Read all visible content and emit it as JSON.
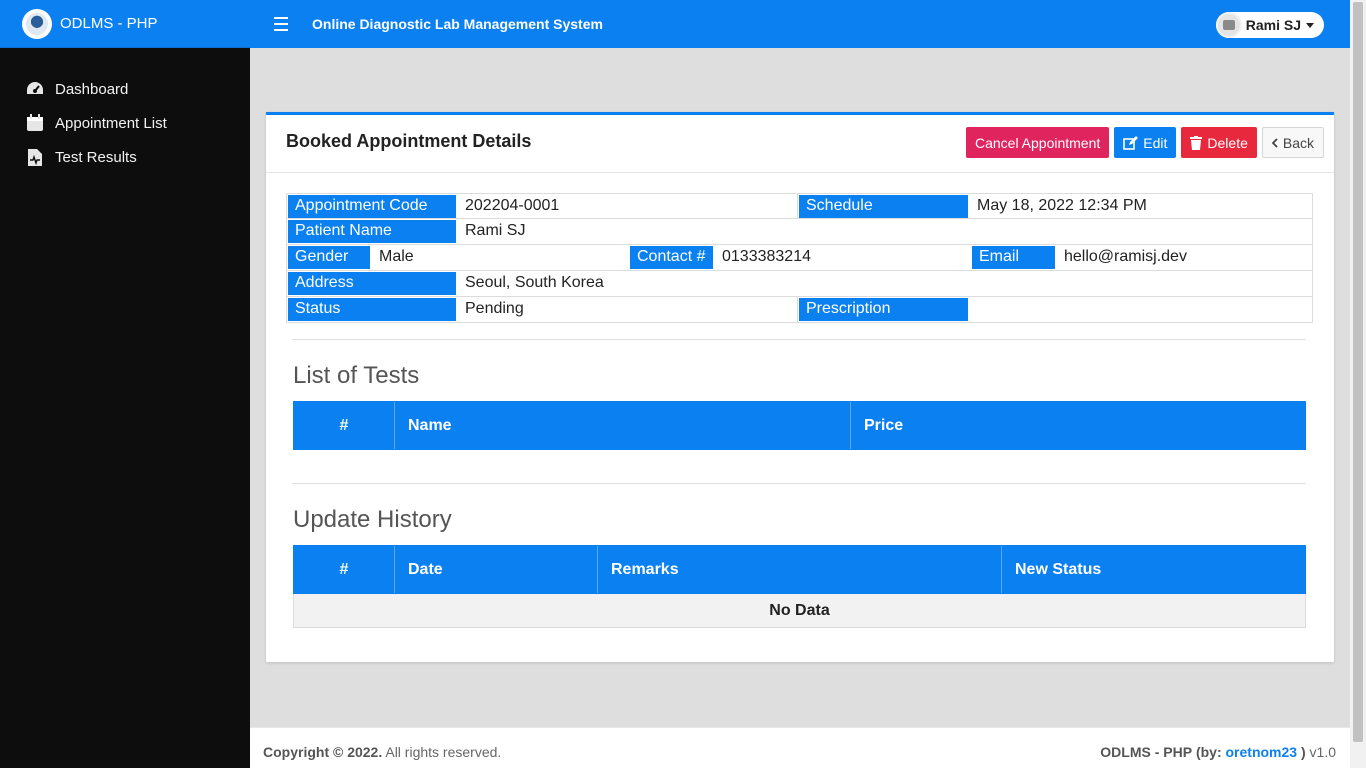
{
  "brand": {
    "title": "ODLMS - PHP"
  },
  "sidebar": {
    "items": [
      {
        "label": "Dashboard",
        "icon": "dashboard-gauge-icon"
      },
      {
        "label": "Appointment List",
        "icon": "calendar-icon"
      },
      {
        "label": "Test Results",
        "icon": "file-medical-icon"
      }
    ]
  },
  "header": {
    "system_title": "Online Diagnostic Lab Management System",
    "user_name": "Rami SJ"
  },
  "card": {
    "title": "Booked Appointment Details",
    "buttons": {
      "cancel": "Cancel Appointment",
      "edit": "Edit",
      "delete": "Delete",
      "back": "Back"
    }
  },
  "details": {
    "appointment_code_label": "Appointment Code",
    "appointment_code": "202204-0001",
    "schedule_label": "Schedule",
    "schedule": "May 18, 2022 12:34 PM",
    "patient_name_label": "Patient Name",
    "patient_name": "Rami SJ",
    "gender_label": "Gender",
    "gender": "Male",
    "contact_label": "Contact #",
    "contact": "0133383214",
    "email_label": "Email",
    "email": "hello@ramisj.dev",
    "address_label": "Address",
    "address": "Seoul, South Korea",
    "status_label": "Status",
    "status": "Pending",
    "prescription_label": "Prescription",
    "prescription": ""
  },
  "tests": {
    "title": "List of Tests",
    "columns": [
      "#",
      "Name",
      "Price"
    ],
    "rows": []
  },
  "history": {
    "title": "Update History",
    "columns": [
      "#",
      "Date",
      "Remarks",
      "New Status"
    ],
    "empty_text": "No Data"
  },
  "footer": {
    "copyright": "Copyright © 2022.",
    "rights": "All rights reserved.",
    "app": "ODLMS - PHP",
    "by_prefix": "(by:",
    "author": "oretnom23",
    "by_suffix": ")",
    "version": "v1.0"
  },
  "colors": {
    "primary": "#0b80f0",
    "cancel": "#e0245e",
    "delete": "#e8283c",
    "sidebar": "#0d0d0d"
  }
}
